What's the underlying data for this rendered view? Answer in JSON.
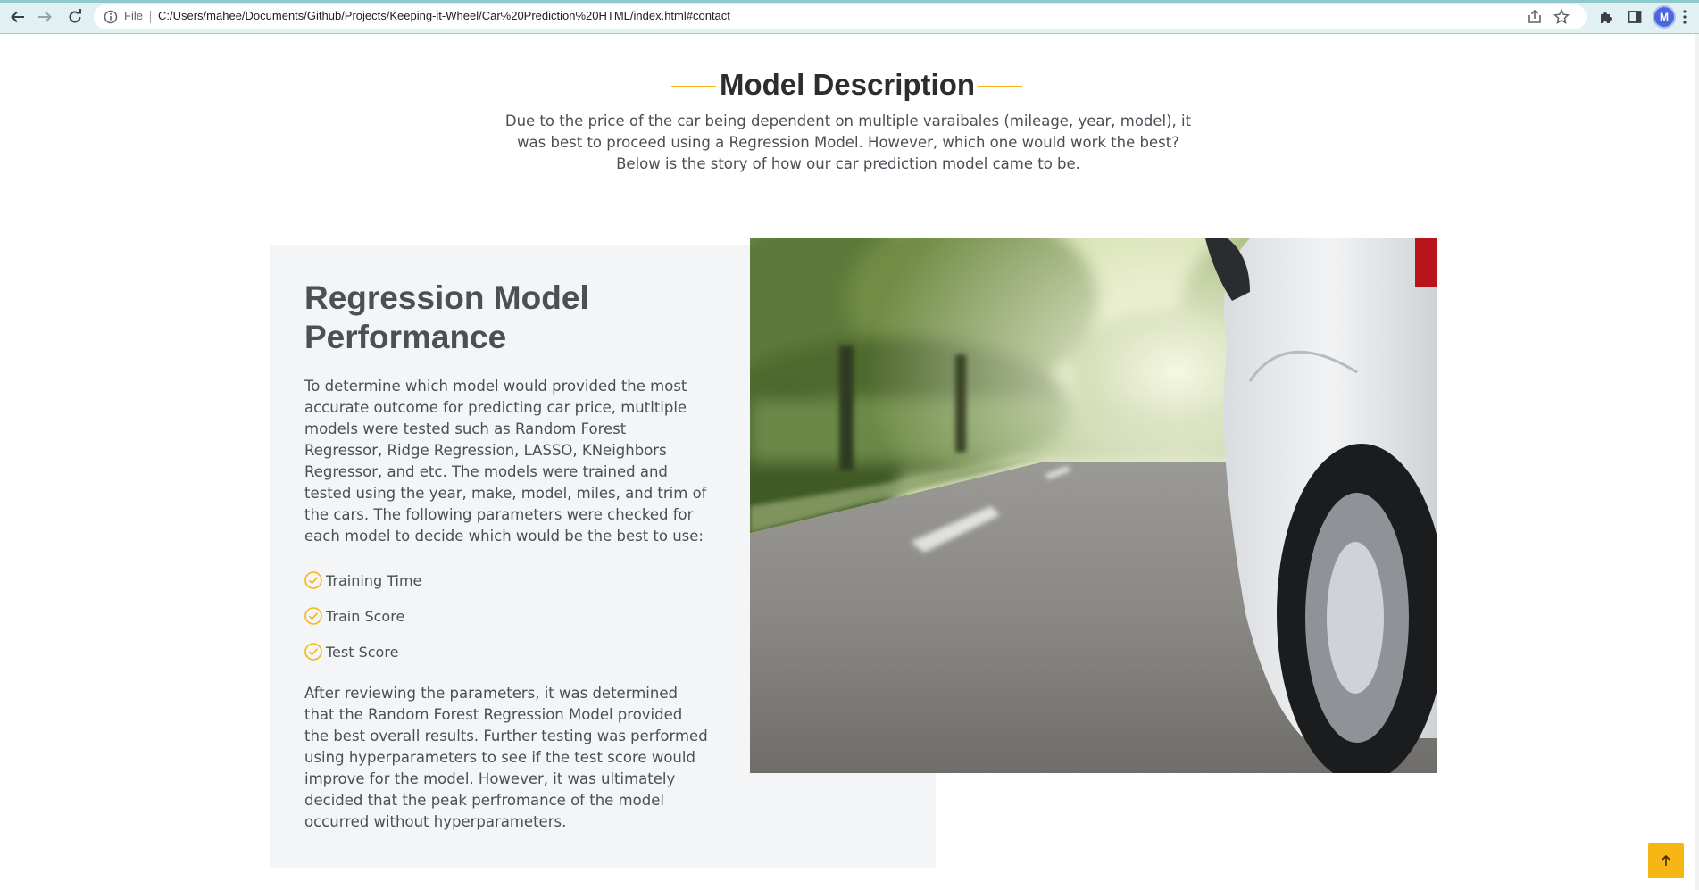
{
  "browser": {
    "scheme_label": "File",
    "url": "C:/Users/mahee/Documents/Github/Projects/Keeping-it-Wheel/Car%20Prediction%20HTML/index.html#contact",
    "profile_initial": "M"
  },
  "section": {
    "title": "Model Description",
    "description": "Due to the price of the car being dependent on multiple varaibales (mileage, year, model), it was best to proceed using a Regression Model. However, which one would work the best? Below is the story of how our car prediction model came to be."
  },
  "card": {
    "title": "Regression Model Performance",
    "intro": "To determine which model would provided the most accurate outcome for predicting car price, mutltiple models were tested such as Random Forest Regressor, Ridge Regression, LASSO, KNeighbors Regressor, and etc. The models were trained and tested using the year, make, model, miles, and trim of the cars. The following parameters were checked for each model to decide which would be the best to use:",
    "checklist": [
      "Training Time",
      "Train Score",
      "Test Score"
    ],
    "conclusion": "After reviewing the parameters, it was determined that the Random Forest Regression Model provided the best overall results. Further testing was performed using hyperparameters to see if the test score would improve for the model. However, it was ultimately decided that the peak perfromance of the model occurred without hyperparameters."
  },
  "colors": {
    "accent": "#f7b614",
    "card_bg": "#f4f5f7",
    "text": "#4a4f55",
    "heading": "#2d2d2d"
  },
  "icons": {
    "back": "arrow-left-icon",
    "forward": "arrow-right-icon",
    "reload": "reload-icon",
    "info": "info-icon",
    "share": "share-icon",
    "bookmark": "star-icon",
    "extensions": "puzzle-icon",
    "side_panel": "side-panel-icon",
    "menu": "kebab-menu-icon",
    "check": "check-circle-icon",
    "back_to_top": "arrow-up-icon"
  }
}
